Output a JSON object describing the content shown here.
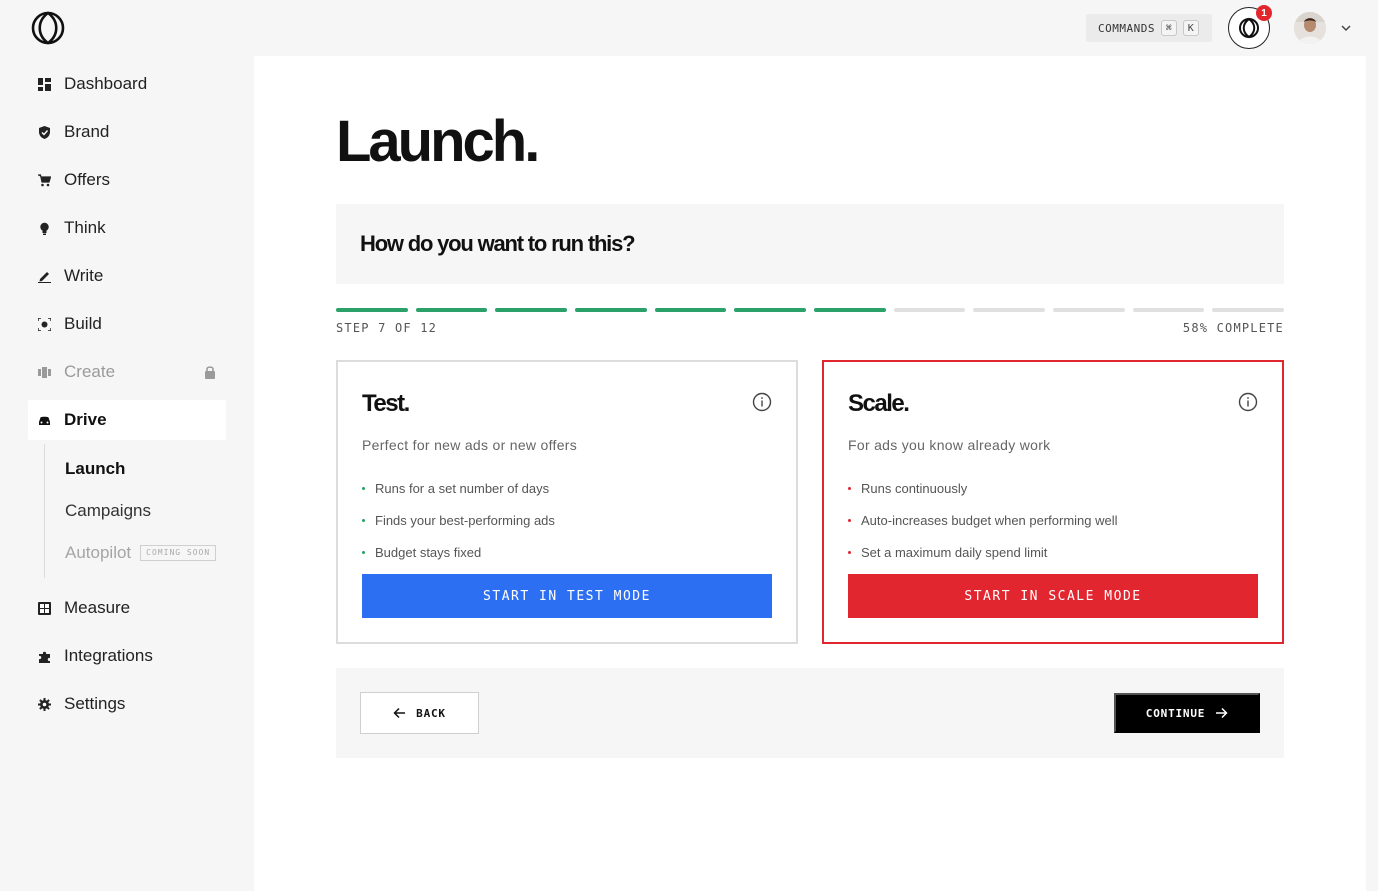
{
  "topbar": {
    "commands_label": "COMMANDS",
    "shortcut_keys": [
      "⌘",
      "K"
    ],
    "notification_count": "1"
  },
  "sidebar": {
    "items": [
      {
        "label": "Dashboard",
        "icon": "dashboard-icon"
      },
      {
        "label": "Brand",
        "icon": "shield-icon"
      },
      {
        "label": "Offers",
        "icon": "cart-icon"
      },
      {
        "label": "Think",
        "icon": "lightbulb-icon"
      },
      {
        "label": "Write",
        "icon": "pen-icon"
      },
      {
        "label": "Build",
        "icon": "build-icon"
      },
      {
        "label": "Create",
        "icon": "create-icon",
        "locked": true
      },
      {
        "label": "Drive",
        "icon": "car-icon",
        "active": true
      },
      {
        "label": "Measure",
        "icon": "table-icon"
      },
      {
        "label": "Integrations",
        "icon": "puzzle-icon"
      },
      {
        "label": "Settings",
        "icon": "gear-icon"
      }
    ],
    "drive_subitems": [
      {
        "label": "Launch",
        "active": true
      },
      {
        "label": "Campaigns"
      },
      {
        "label": "Autopilot",
        "badge": "COMING SOON"
      }
    ]
  },
  "main": {
    "title": "Launch.",
    "question": "How do you want to run this?",
    "progress": {
      "current_step": 7,
      "total_steps": 12,
      "step_text": "STEP 7 OF 12",
      "percent_text": "58% COMPLETE"
    },
    "cards": {
      "test": {
        "title": "Test.",
        "subtitle": "Perfect for new ads or new offers",
        "bullets": [
          "Runs for a set number of days",
          "Finds your best-performing ads",
          "Budget stays fixed"
        ],
        "cta": "START IN TEST MODE"
      },
      "scale": {
        "title": "Scale.",
        "subtitle": "For ads you know already work",
        "bullets": [
          "Runs continuously",
          "Auto-increases budget when performing well",
          "Set a maximum daily spend limit"
        ],
        "cta": "START IN SCALE MODE"
      }
    },
    "footer": {
      "back_label": "BACK",
      "continue_label": "CONTINUE"
    }
  },
  "colors": {
    "progress_done": "#2aa169",
    "test_accent": "#2d6ff2",
    "scale_accent": "#e1262f",
    "badge": "#e1262c"
  }
}
